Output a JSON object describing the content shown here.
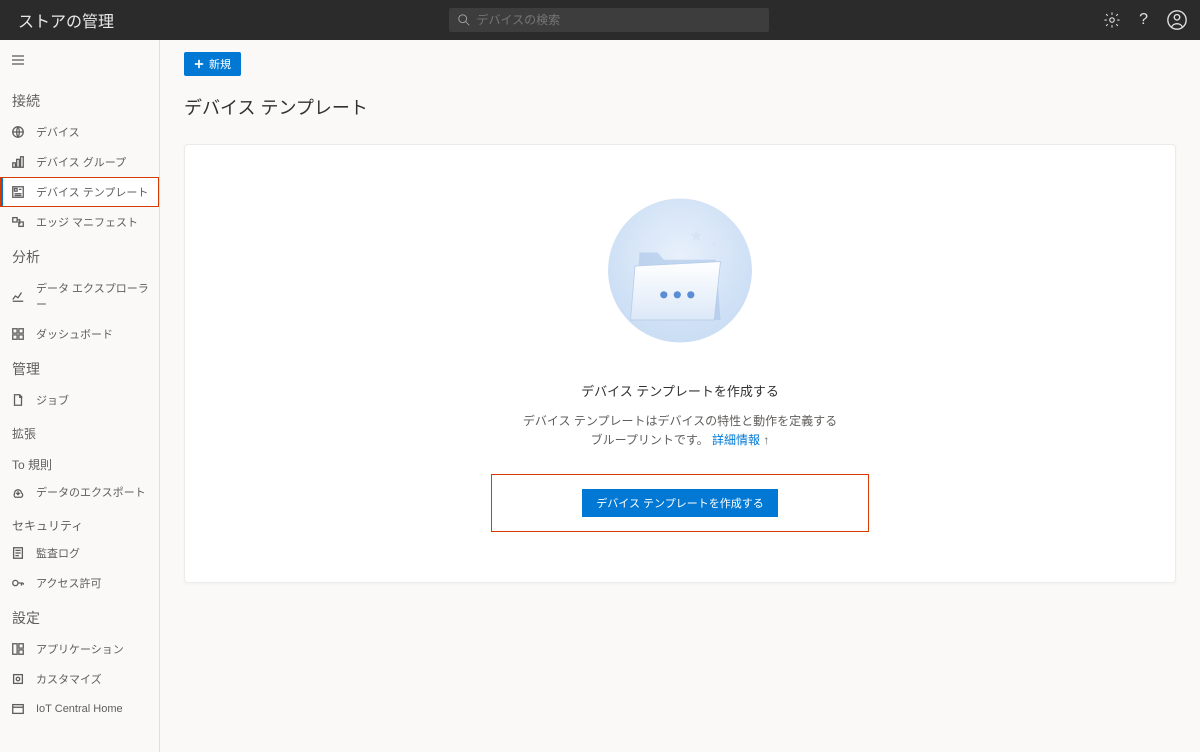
{
  "header": {
    "title": "ストアの管理",
    "search_placeholder": "デバイスの検索"
  },
  "sidebar": {
    "sections": {
      "connect": {
        "label": "接続"
      },
      "analyze": {
        "label": "分析"
      },
      "manage": {
        "label": "管理"
      },
      "extend": {
        "label": "拡張"
      },
      "to_rules": {
        "label": "To 規則"
      },
      "security": {
        "label": "セキュリティ"
      },
      "settings": {
        "label": "設定"
      }
    },
    "items": {
      "devices": "デバイス",
      "device_groups": "デバイス グループ",
      "device_templates": "デバイス テンプレート",
      "edge_manifest": "エッジ マニフェスト",
      "data_explorer": "データ エクスプローラー",
      "dashboard": "ダッシュボード",
      "jobs": "ジョブ",
      "data_export": "データのエクスポート",
      "audit_log": "監査ログ",
      "permissions": "アクセス許可",
      "application": "アプリケーション",
      "customize": "カスタマイズ",
      "iot_home": "IoT Central Home"
    }
  },
  "toolbar": {
    "new_label": "新規"
  },
  "page": {
    "title": "デバイス テンプレート"
  },
  "empty_state": {
    "title": "デバイス テンプレートを作成する",
    "desc_line1": "デバイス テンプレートはデバイスの特性と動作を定義する",
    "desc_line2_prefix": "ブループリントです。",
    "desc_link": "詳細情報",
    "button": "デバイス テンプレートを作成する"
  }
}
